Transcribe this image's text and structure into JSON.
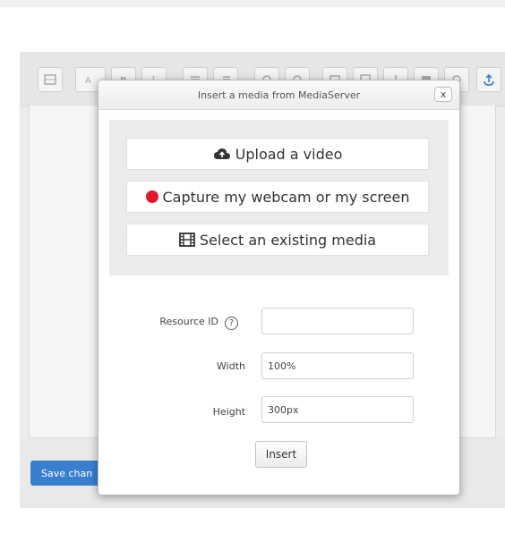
{
  "editor": {
    "save_label": "Save chan",
    "toolbar_icons": [
      "image-icon",
      "font-icon",
      "bold-icon",
      "italic-icon",
      "list-icon",
      "list-ordered-icon",
      "link-icon",
      "unlink-icon",
      "media-icon",
      "code-icon",
      "anchor-icon",
      "table-icon",
      "special-char-icon",
      "upload-icon"
    ]
  },
  "dialog": {
    "title": "Insert a media from MediaServer",
    "close_label": "x",
    "buttons": {
      "upload": "Upload a video",
      "capture": "Capture my webcam or my screen",
      "select": "Select an existing media"
    },
    "icons": {
      "upload": "cloud-upload-icon",
      "capture": "record-icon",
      "select": "film-icon"
    },
    "colors": {
      "record": "#e2172a",
      "save_button": "#3a7fcf"
    },
    "form": {
      "resource_id_label": "Resource ID",
      "resource_id_value": "",
      "help_symbol": "?",
      "width_label": "Width",
      "width_value": "100%",
      "height_label": "Height",
      "height_value": "300px",
      "insert_label": "Insert"
    }
  }
}
